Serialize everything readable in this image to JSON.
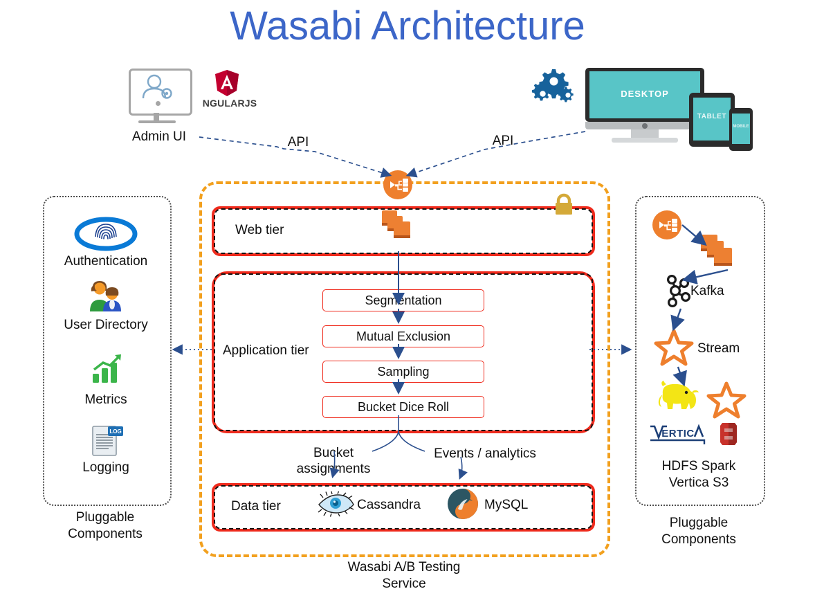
{
  "title": "Wasabi Architecture",
  "colors": {
    "title_blue": "#3c66c8",
    "boundary_orange": "#f2a01e",
    "tier_red": "#ef2b1d",
    "accent_orange": "#ed8032",
    "arrow_blue": "#2b4f8e",
    "device_teal": "#58c5c7",
    "lock_gold": "#d4a938"
  },
  "clients": {
    "admin_ui_label": "Admin UI",
    "angular_logo_text": "NGULARJS",
    "angular_letter": "A",
    "devices": {
      "desktop_label": "DESKTOP",
      "tablet_label": "TABLET",
      "mobile_label": "MOBILE"
    },
    "api_left_label": "API",
    "api_right_label": "API"
  },
  "wasabi": {
    "caption": "Wasabi A/B Testing\nService",
    "caption_line1": "Wasabi A/B Testing",
    "caption_line2": "Service",
    "web_tier": {
      "name": "Web tier"
    },
    "app_tier": {
      "name": "Application tier",
      "steps": [
        {
          "label": "Segmentation"
        },
        {
          "label": "Mutual Exclusion"
        },
        {
          "label": "Sampling"
        },
        {
          "label": "Bucket Dice Roll"
        }
      ]
    },
    "data_tier": {
      "name": "Data tier",
      "stores": [
        {
          "label": "Cassandra",
          "icon": "cassandra-eye-icon"
        },
        {
          "label": "MySQL",
          "icon": "mysql-dolphin-icon"
        }
      ]
    },
    "flow_labels": {
      "bucket_assignments_line1": "Bucket",
      "bucket_assignments_line2": "assignments",
      "events_analytics": "Events / analytics"
    }
  },
  "left_panel": {
    "caption_line1": "Pluggable",
    "caption_line2": "Components",
    "items": [
      {
        "label": "Authentication",
        "icon": "fingerprint-icon"
      },
      {
        "label": "User Directory",
        "icon": "users-icon"
      },
      {
        "label": "Metrics",
        "icon": "bar-chart-icon"
      },
      {
        "label": "Logging",
        "icon": "log-document-icon"
      }
    ]
  },
  "right_panel": {
    "caption_line1": "Pluggable",
    "caption_line2": "Components",
    "kafka_label": "Kafka",
    "stream_label": "Stream",
    "stack_line1": "HDFS Spark",
    "stack_line2": "Vertica S3",
    "icons": [
      {
        "name": "load-balancer-icon"
      },
      {
        "name": "server-stack-icon"
      },
      {
        "name": "kafka-icon"
      },
      {
        "name": "stream-star-icon"
      },
      {
        "name": "hadoop-elephant-icon"
      },
      {
        "name": "spark-star-icon"
      },
      {
        "name": "vertica-icon"
      },
      {
        "name": "s3-icon"
      }
    ]
  }
}
